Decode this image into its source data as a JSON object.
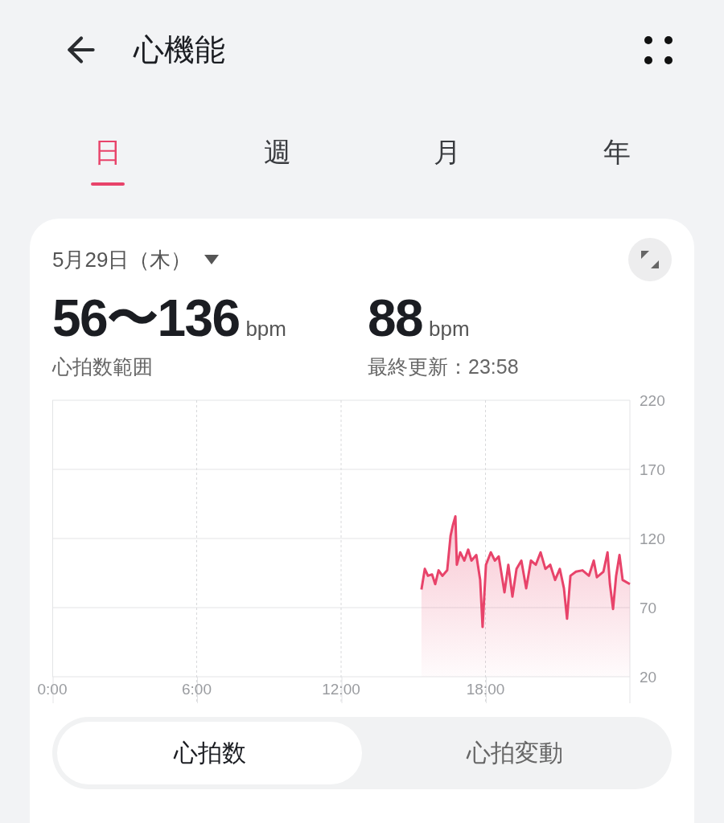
{
  "header": {
    "title": "心機能"
  },
  "tabs": [
    {
      "label": "日",
      "selected": true
    },
    {
      "label": "週",
      "selected": false
    },
    {
      "label": "月",
      "selected": false
    },
    {
      "label": "年",
      "selected": false
    }
  ],
  "card": {
    "date": "5月29日（木）",
    "stats": [
      {
        "value": "56〜136",
        "unit": "bpm",
        "label": "心拍数範囲"
      },
      {
        "value": "88",
        "unit": "bpm",
        "label": "最終更新：23:58"
      }
    ],
    "chart_data": {
      "type": "area",
      "xlim": [
        0,
        24
      ],
      "ylim": [
        20,
        220
      ],
      "xticks": [
        {
          "value": 0,
          "label": "0:00"
        },
        {
          "value": 6,
          "label": "6:00"
        },
        {
          "value": 12,
          "label": "12:00"
        },
        {
          "value": 18,
          "label": "18:00"
        }
      ],
      "yticks": [
        20,
        70,
        120,
        170,
        220
      ],
      "grid": true,
      "x": [
        15.34,
        15.48,
        15.61,
        15.78,
        15.91,
        16.05,
        16.21,
        16.41,
        16.55,
        16.65,
        16.75,
        16.81,
        16.95,
        17.12,
        17.28,
        17.42,
        17.62,
        17.78,
        17.88,
        18.02,
        18.22,
        18.39,
        18.55,
        18.79,
        18.95,
        19.12,
        19.29,
        19.49,
        19.69,
        19.89,
        20.09,
        20.29,
        20.49,
        20.69,
        20.89,
        21.09,
        21.26,
        21.39,
        21.53,
        21.76,
        22.03,
        22.3,
        22.5,
        22.63,
        22.9,
        23.07,
        23.17,
        23.3,
        23.43,
        23.57,
        23.7,
        24.0
      ],
      "series": [
        {
          "color": "#e8436a",
          "values": [
            83,
            98,
            93,
            94,
            87,
            97,
            93,
            97,
            122,
            130,
            136,
            101,
            110,
            104,
            112,
            104,
            108,
            90,
            56,
            101,
            110,
            104,
            107,
            81,
            101,
            78,
            98,
            104,
            84,
            104,
            101,
            110,
            98,
            101,
            90,
            98,
            84,
            62,
            93,
            96,
            97,
            93,
            104,
            92,
            96,
            110,
            87,
            69,
            93,
            108,
            90,
            87
          ]
        }
      ]
    },
    "segments": [
      {
        "label": "心拍数",
        "selected": true
      },
      {
        "label": "心拍変動",
        "selected": false
      }
    ]
  }
}
